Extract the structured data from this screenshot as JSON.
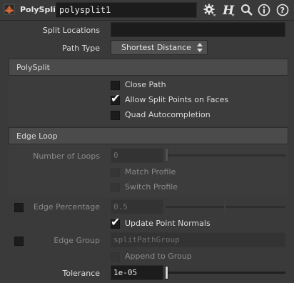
{
  "header": {
    "node_type": "PolySplit",
    "node_name": "polysplit1",
    "icons": [
      "polysplit-node-icon",
      "gear-icon",
      "help-h-icon",
      "search-icon",
      "info-icon",
      "help-icon"
    ]
  },
  "params": {
    "split_locations": {
      "label": "Split Locations",
      "value": ""
    },
    "path_type": {
      "label": "Path Type",
      "value": "Shortest Distance"
    }
  },
  "sections": {
    "polysplit": {
      "title": "PolySplit"
    },
    "edge_loop": {
      "title": "Edge Loop"
    }
  },
  "polysplit": {
    "close_path": {
      "label": "Close Path",
      "checked": false
    },
    "allow_split": {
      "label": "Allow Split Points on Faces",
      "checked": true
    },
    "quad_auto": {
      "label": "Quad Autocompletion",
      "checked": false
    }
  },
  "edge_loop": {
    "number_of_loops": {
      "label": "Number of Loops",
      "value": "0",
      "slider_fraction": 0.0
    },
    "match_profile": {
      "label": "Match Profile",
      "checked": false
    },
    "switch_profile": {
      "label": "Switch Profile",
      "checked": false
    }
  },
  "edge_percentage": {
    "label": "Edge Percentage",
    "value": "0.5",
    "enabled": false,
    "slider_fraction": 0.5
  },
  "update_normals": {
    "label": "Update Point Normals",
    "checked": true
  },
  "edge_group": {
    "label": "Edge Group",
    "value": "splitPathGroup",
    "enabled": false
  },
  "append_group": {
    "label": "Append to Group",
    "checked": false
  },
  "tolerance": {
    "label": "Tolerance",
    "value": "1e-05",
    "slider_fraction": 0.0
  },
  "colors": {
    "bg": "#3a3a3a",
    "field": "#1c1c1c",
    "section": "#4b4b4b",
    "text": "#dcdcdc",
    "dim_text": "#8a8a8a"
  }
}
